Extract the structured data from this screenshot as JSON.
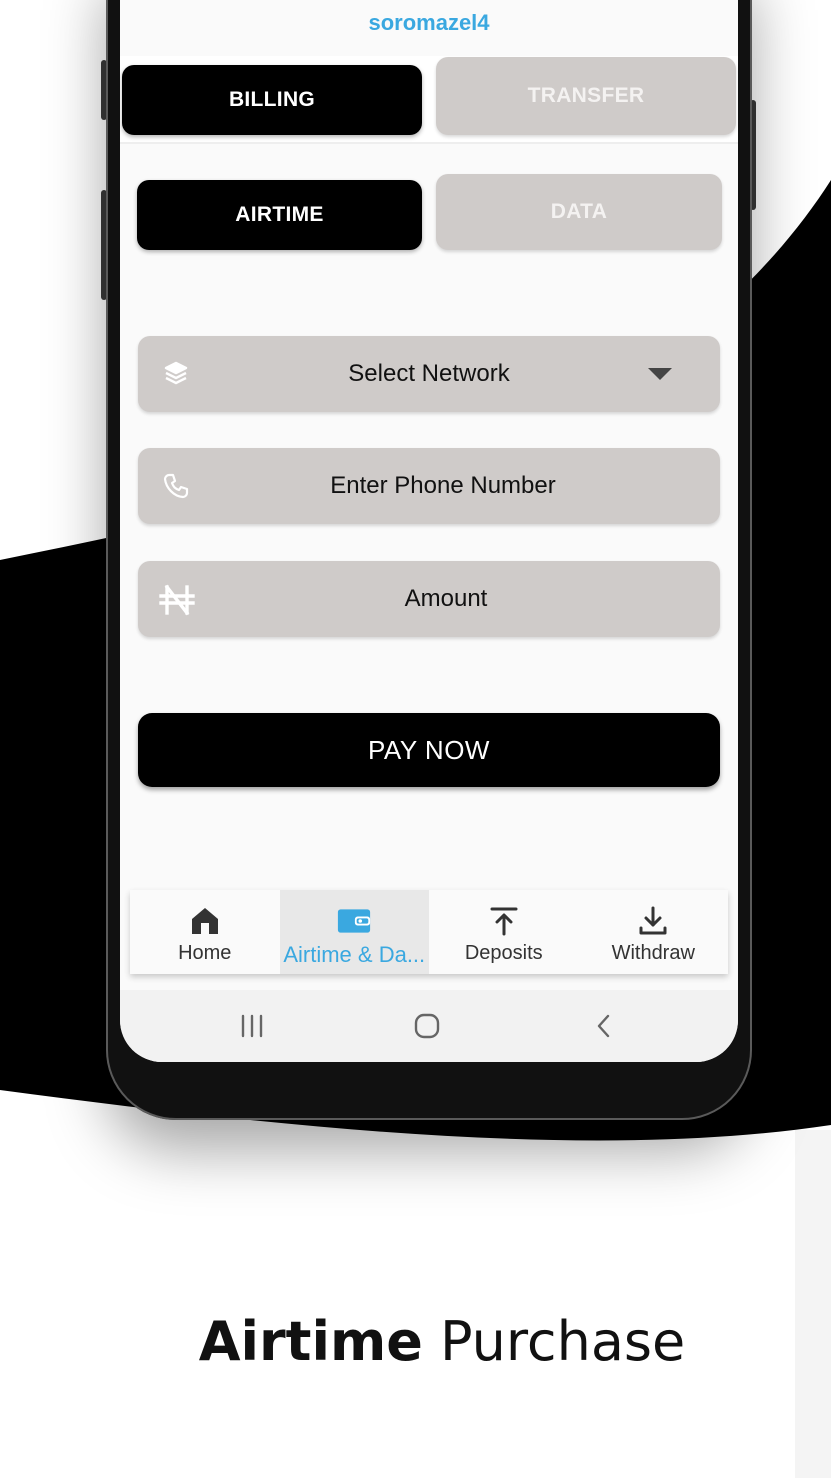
{
  "app": {
    "username": "soromazel4"
  },
  "top_tabs": [
    {
      "label": "BILLING",
      "active": true
    },
    {
      "label": "TRANSFER",
      "active": false
    }
  ],
  "sub_tabs": [
    {
      "label": "AIRTIME",
      "active": true
    },
    {
      "label": "DATA",
      "active": false
    }
  ],
  "form": {
    "network": {
      "value": "Select Network",
      "icon": "layers-icon"
    },
    "phone": {
      "placeholder": "Enter Phone Number",
      "icon": "phone-icon"
    },
    "amount": {
      "placeholder": "Amount",
      "icon": "naira-icon"
    },
    "submit_label": "PAY NOW"
  },
  "bottom_nav": [
    {
      "label": "Home",
      "icon": "home-icon",
      "active": false
    },
    {
      "label": "Airtime & Da...",
      "icon": "wallet-icon",
      "active": true
    },
    {
      "label": "Deposits",
      "icon": "upload-icon",
      "active": false
    },
    {
      "label": "Withdraw",
      "icon": "download-icon",
      "active": false
    }
  ],
  "system_nav": [
    "recents-icon",
    "home-circle-icon",
    "back-icon"
  ],
  "caption": {
    "bold": "Airtime",
    "regular": "Purchase"
  },
  "colors": {
    "accent": "#3aa8e0",
    "active_tab": "#000000",
    "inactive_tab": "#cfcbc9",
    "field_bg": "#cfcbc9"
  }
}
